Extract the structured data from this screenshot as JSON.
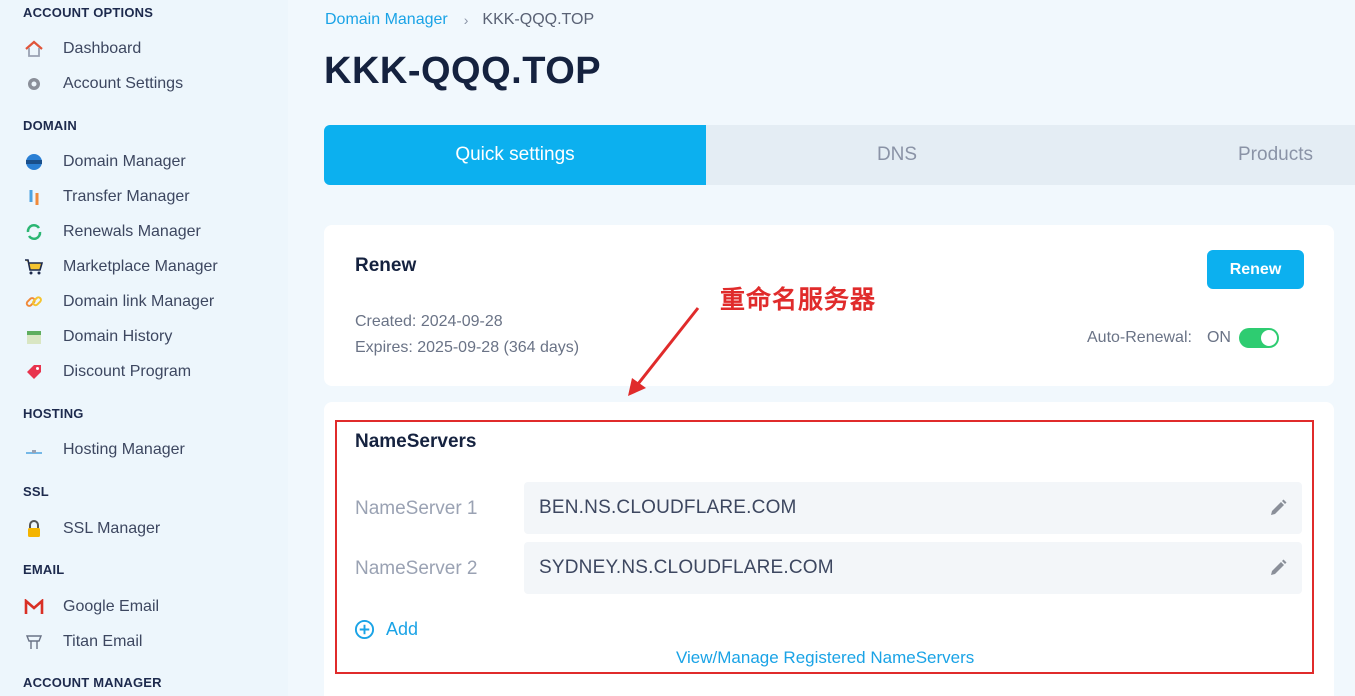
{
  "sidebar": {
    "sections": [
      {
        "title": "ACCOUNT OPTIONS"
      },
      {
        "title": "DOMAIN"
      },
      {
        "title": "HOSTING"
      },
      {
        "title": "SSL"
      },
      {
        "title": "EMAIL"
      },
      {
        "title": "ACCOUNT MANAGER"
      }
    ],
    "items": [
      {
        "label": "Dashboard",
        "icon": "home-icon"
      },
      {
        "label": "Account Settings",
        "icon": "gear-icon"
      },
      {
        "label": "Domain Manager",
        "icon": "www-globe-icon"
      },
      {
        "label": "Transfer Manager",
        "icon": "transfer-icon"
      },
      {
        "label": "Renewals Manager",
        "icon": "refresh-icon"
      },
      {
        "label": "Marketplace Manager",
        "icon": "cart-icon"
      },
      {
        "label": "Domain link Manager",
        "icon": "link-icon"
      },
      {
        "label": "Domain History",
        "icon": "calendar-icon"
      },
      {
        "label": "Discount Program",
        "icon": "tag-icon"
      },
      {
        "label": "Hosting Manager",
        "icon": "server-icon"
      },
      {
        "label": "SSL Manager",
        "icon": "lock-icon"
      },
      {
        "label": "Google Email",
        "icon": "gmail-icon"
      },
      {
        "label": "Titan Email",
        "icon": "titan-icon"
      }
    ]
  },
  "breadcrumb": {
    "parent": "Domain Manager",
    "separator": "›",
    "current": "KKK-QQQ.TOP"
  },
  "page_title": "KKK-QQQ.TOP",
  "tabs": [
    {
      "label": "Quick settings",
      "active": true
    },
    {
      "label": "DNS",
      "active": false
    },
    {
      "label": "Products",
      "active": false
    }
  ],
  "renew": {
    "title": "Renew",
    "button": "Renew",
    "created": "Created: 2024-09-28",
    "expires": "Expires: 2025-09-28 (364 days)",
    "auto_renewal_label": "Auto-Renewal:",
    "auto_renewal_value": "ON"
  },
  "annotation": {
    "text": "重命名服务器",
    "color": "#e02b2b"
  },
  "nameservers": {
    "title": "NameServers",
    "rows": [
      {
        "label": "NameServer 1",
        "value": "BEN.NS.CLOUDFLARE.COM"
      },
      {
        "label": "NameServer 2",
        "value": "SYDNEY.NS.CLOUDFLARE.COM"
      }
    ],
    "add_label": "Add",
    "view_link": "View/Manage Registered NameServers"
  },
  "colors": {
    "accent": "#0cb0ef",
    "link": "#1aa3e6",
    "toggle_on": "#2ecc71",
    "annotation": "#e02b2b"
  }
}
